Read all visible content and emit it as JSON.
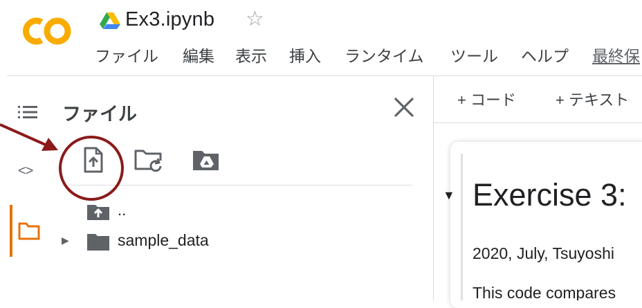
{
  "header": {
    "logo_text": "CO",
    "doc_title": "Ex3.ipynb",
    "star_glyph": "☆",
    "menu": [
      {
        "label": "ファイル"
      },
      {
        "label": "編集"
      },
      {
        "label": "表示"
      },
      {
        "label": "挿入"
      },
      {
        "label": "ランタイム"
      },
      {
        "label": "ツール"
      },
      {
        "label": "ヘルプ"
      },
      {
        "label": "最終保"
      }
    ]
  },
  "rail": {
    "toc_icon": "table-of-contents-icon",
    "code_label": "<>",
    "files_icon": "folder-icon"
  },
  "file_panel": {
    "title": "ファイル",
    "toolbar": [
      {
        "icon": "upload-file-icon"
      },
      {
        "icon": "refresh-folder-icon"
      },
      {
        "icon": "mount-drive-icon"
      }
    ],
    "tree": [
      {
        "label": ".."
      },
      {
        "label": "sample_data"
      }
    ]
  },
  "notebook": {
    "add_code_label": "+ コード",
    "add_text_label": "+ テキスト",
    "heading": "Exercise 3:",
    "subtext": "2020, July, Tsuyoshi",
    "body": "This code compares"
  },
  "colors": {
    "logo_orange": "#f9ab00",
    "active_accent": "#e8710a",
    "annotation_red": "#8b1a1a"
  }
}
